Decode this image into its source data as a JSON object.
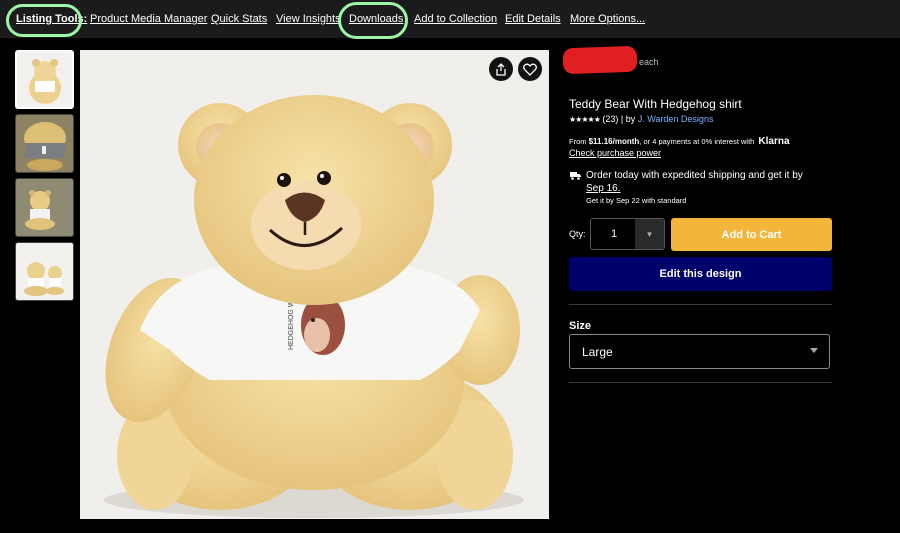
{
  "toolbar": {
    "listing_tools_label": "Listing Tools:",
    "links": [
      "Product Media Manager",
      "Quick Stats",
      "View Insights",
      "Downloads",
      "Add to Collection",
      "Edit Details",
      "More Options..."
    ],
    "highlight_color": "#9ef5a6"
  },
  "gallery": {
    "thumbnails": [
      "thumbnail-1",
      "thumbnail-2",
      "thumbnail-3",
      "thumbnail-4"
    ],
    "main_image_alt": "teddy-bear-with-hedgehog-shirt",
    "shirt_print": "HEDGEHOG WEIGHT",
    "share_icon": "share-icon",
    "heart_icon": "heart-icon"
  },
  "product": {
    "price_suffix": "each",
    "title": "Teddy Bear With Hedgehog shirt",
    "stars": "★★★★★",
    "rating_count": "(23)",
    "by_separator": " | by ",
    "brand": "J. Warden Designs",
    "klarna_prefix": "From ",
    "klarna_amount": "$11.16/month",
    "klarna_suffix": ", or 4 payments at 0% interest with ",
    "klarna_logo": "Klarna",
    "check_power": "Check purchase power",
    "shipping_line1": "Order today with expedited shipping and get it by",
    "shipping_date": "Sep 16",
    "shipping_period": ".",
    "shipping_line2": "Get it by Sep 22 with standard",
    "qty_label": "Qty:",
    "qty_value": "1",
    "add_to_cart": "Add to Cart",
    "edit_design": "Edit this design",
    "size_label": "Size",
    "size_value": "Large",
    "colors": {
      "add_to_cart": "#f4b53b",
      "edit_design": "#00006b",
      "brand_link": "#7db3ff",
      "redaction": "#e02020"
    }
  }
}
